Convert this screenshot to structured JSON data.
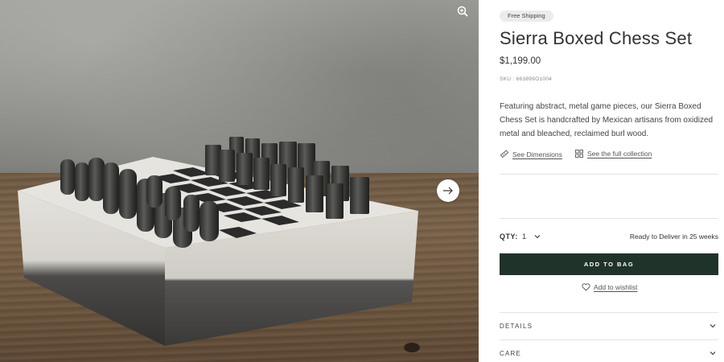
{
  "image": {
    "alt": "Sierra Boxed Chess Set on wooden table",
    "zoom_icon": "zoom-in-icon",
    "next_icon": "arrow-right-icon"
  },
  "product": {
    "badge": "Free Shipping",
    "title": "Sierra Boxed Chess Set",
    "price": "$1,199.00",
    "sku": "SKU : 663899O1004",
    "description": "Featuring abstract, metal game pieces, our Sierra Boxed Chess Set is handcrafted by Mexican artisans from oxidized metal and bleached, reclaimed burl wood."
  },
  "links": {
    "dimensions": "See Dimensions",
    "dimensions_icon": "ruler-icon",
    "collection": "See the full collection",
    "collection_icon": "grid-icon"
  },
  "purchase": {
    "qty_label": "QTY:",
    "qty_value": "1",
    "delivery": "Ready to Deliver in 25 weeks",
    "add_to_bag": "ADD TO BAG",
    "wishlist": "Add to wishlist",
    "wishlist_icon": "heart-icon"
  },
  "accordions": [
    {
      "label": "DETAILS"
    },
    {
      "label": "CARE"
    }
  ],
  "colors": {
    "add_button_bg": "#20332b",
    "badge_bg": "#ececea"
  }
}
